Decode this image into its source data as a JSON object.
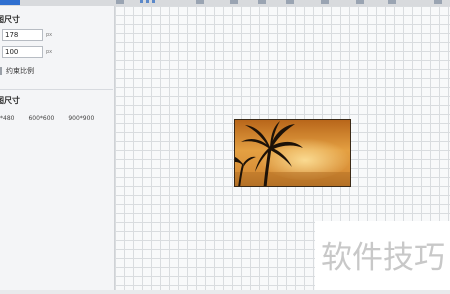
{
  "panel": {
    "size_title": "图尺寸",
    "width_value": "178",
    "height_value": "100",
    "unit": "px",
    "constrain_label": "约束比例",
    "preset_title": "图尺寸",
    "presets": [
      "*480",
      "600*600",
      "900*900"
    ]
  },
  "watermark": {
    "text": "软件技巧"
  },
  "colors": {
    "accent": "#2f6fd0",
    "panel_bg": "#f4f5f7",
    "grid_line": "#d9dcdf",
    "sky_top": "#c4781e",
    "sky_mid": "#e8a640",
    "palm": "#1d1208"
  },
  "icons": [
    "palm-tree-photo",
    "checkbox-icon"
  ]
}
